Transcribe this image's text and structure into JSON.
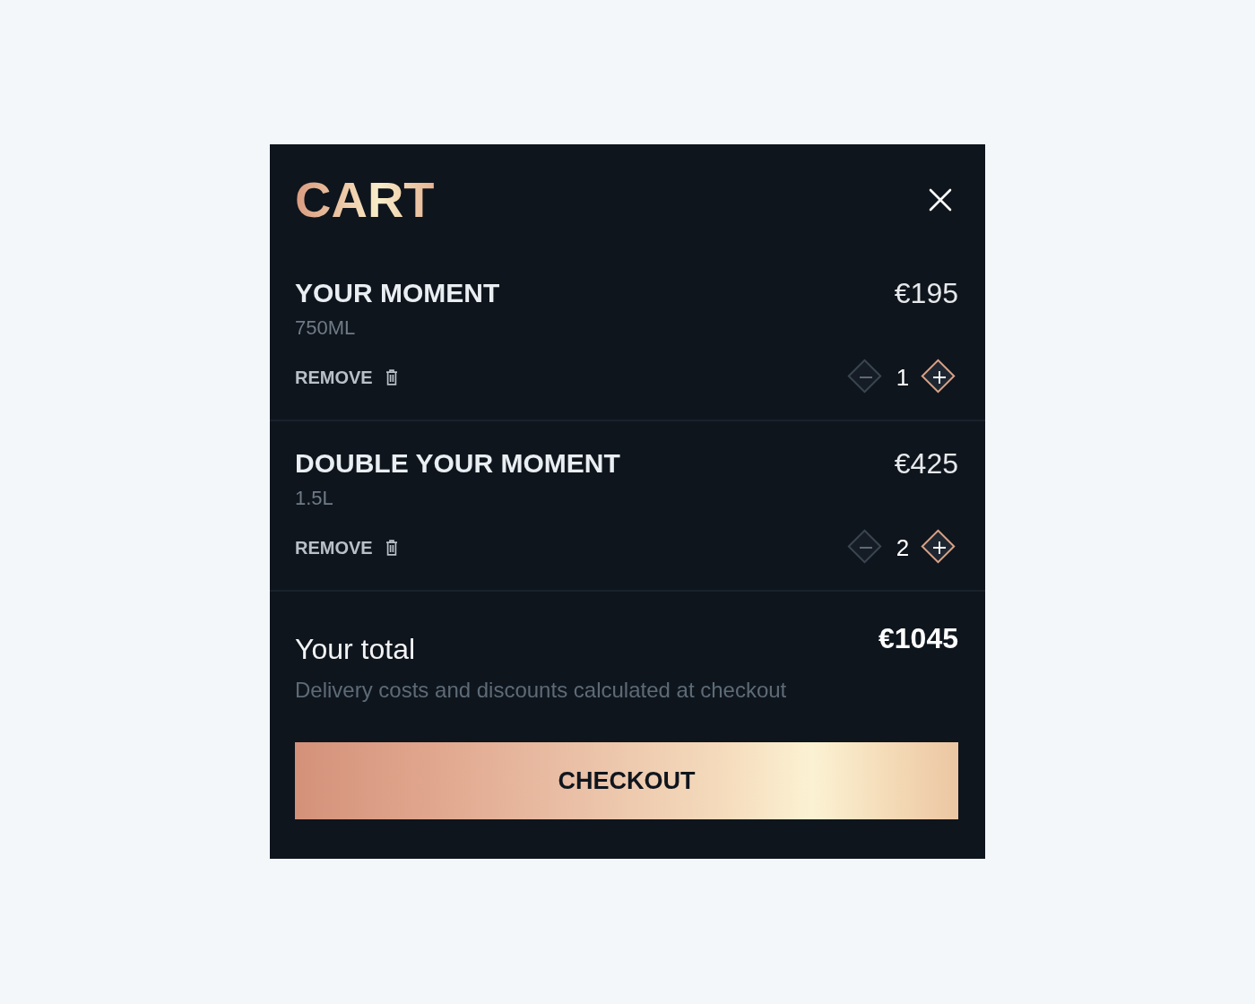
{
  "cart": {
    "title": "CART",
    "items": [
      {
        "name": "YOUR MOMENT",
        "size": "750ML",
        "price": "€195",
        "remove_label": "REMOVE",
        "quantity": "1"
      },
      {
        "name": "DOUBLE YOUR MOMENT",
        "size": "1.5L",
        "price": "€425",
        "remove_label": "REMOVE",
        "quantity": "2"
      }
    ],
    "total": {
      "label": "Your total",
      "amount": "€1045",
      "note": "Delivery costs and discounts calculated at checkout"
    },
    "checkout_button": "CHECKOUT"
  }
}
